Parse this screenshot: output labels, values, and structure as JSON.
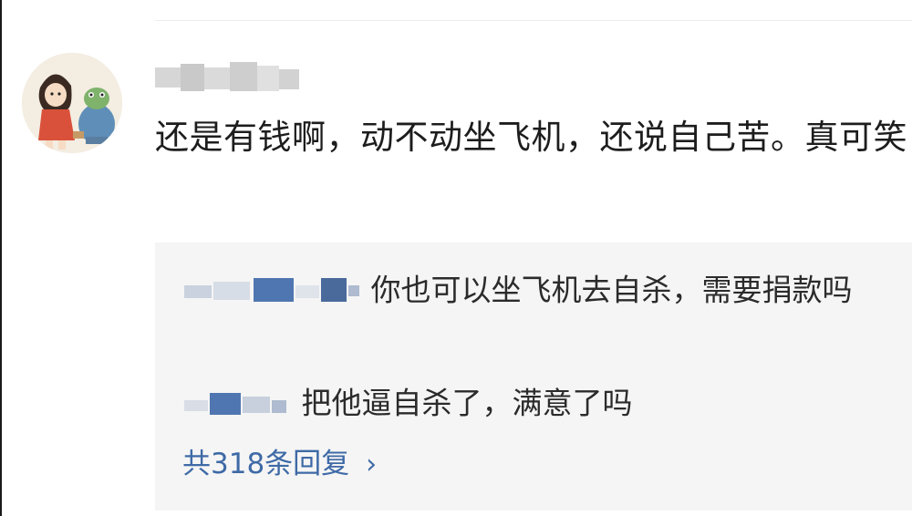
{
  "comment": {
    "username_blurred": "",
    "text": "还是有钱啊，动不动坐飞机，还说自己苦。真可笑"
  },
  "replies": [
    {
      "user_blurred": "",
      "text": "你也可以坐飞机去自杀，需要捐款吗"
    },
    {
      "user_blurred": "",
      "text": "把他逼自杀了，满意了吗"
    }
  ],
  "more_replies": {
    "label": "共318条回复",
    "chevron_icon": "chevron-right-icon"
  },
  "colors": {
    "link": "#3e6aa6",
    "reply_bg": "#f5f5f5",
    "text": "#1d1d1d"
  }
}
